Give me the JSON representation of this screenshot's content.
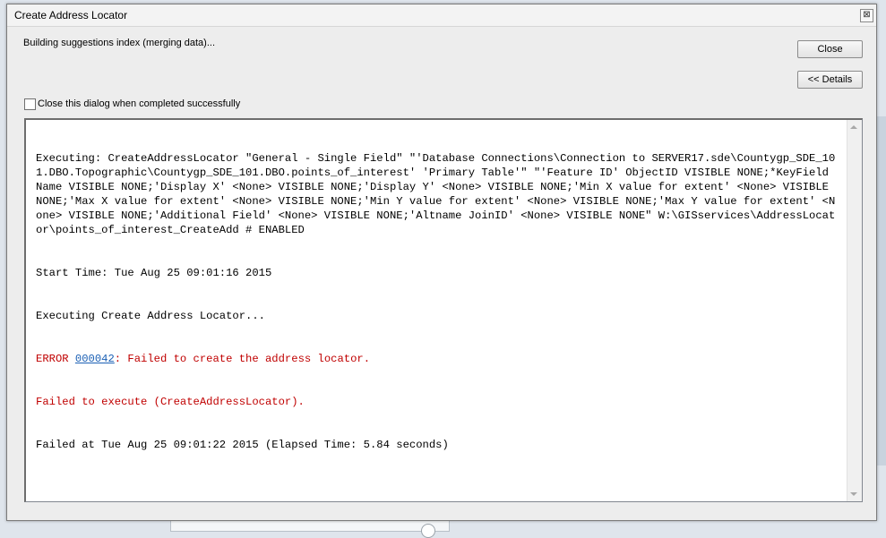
{
  "window": {
    "title": "Create Address Locator",
    "close_glyph": "⊠"
  },
  "status_text": "Building suggestions index (merging data)...",
  "buttons": {
    "close_label": "Close",
    "details_label": "<< Details"
  },
  "checkbox": {
    "label": "Close this dialog when completed successfully",
    "checked": false
  },
  "log": {
    "executing": "Executing: CreateAddressLocator \"General - Single Field\" \"'Database Connections\\Connection to SERVER17.sde\\Countygp_SDE_101.DBO.Topographic\\Countygp_SDE_101.DBO.points_of_interest' 'Primary Table'\" \"'Feature ID' ObjectID VISIBLE NONE;*KeyField Name VISIBLE NONE;'Display X' <None> VISIBLE NONE;'Display Y' <None> VISIBLE NONE;'Min X value for extent' <None> VISIBLE NONE;'Max X value for extent' <None> VISIBLE NONE;'Min Y value for extent' <None> VISIBLE NONE;'Max Y value for extent' <None> VISIBLE NONE;'Additional Field' <None> VISIBLE NONE;'Altname JoinID' <None> VISIBLE NONE\" W:\\GISservices\\AddressLocator\\points_of_interest_CreateAdd # ENABLED",
    "start_time": "Start Time: Tue Aug 25 09:01:16 2015",
    "executing_step": "Executing Create Address Locator...",
    "error_prefix": "ERROR ",
    "error_code": "000042",
    "error_message": ": Failed to create the address locator.",
    "failed_execute": "Failed to execute (CreateAddressLocator).",
    "failed_at": "Failed at Tue Aug 25 09:01:22 2015 (Elapsed Time: 5.84 seconds)"
  },
  "colors": {
    "error": "#c00000",
    "link": "#1a5fb4"
  }
}
